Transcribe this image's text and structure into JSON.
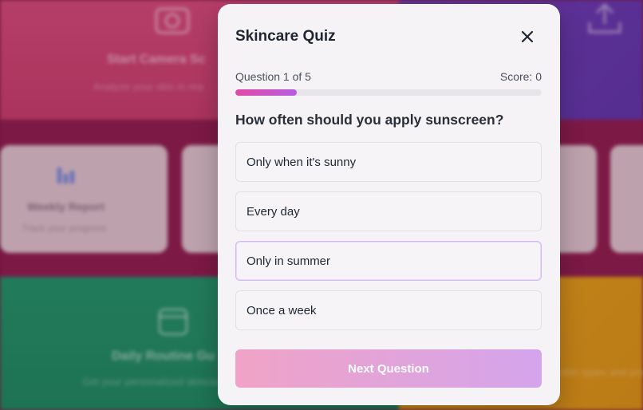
{
  "background": {
    "camera_tile": {
      "title": "Start Camera Sc",
      "subtitle": "Analyze your skin in rea",
      "icon": "camera-icon"
    },
    "upload_tile": {
      "icon": "upload-icon"
    },
    "weekly_card": {
      "title": "Weekly Report",
      "subtitle": "Track your progress",
      "icon": "bar-chart-icon"
    },
    "routine_tile": {
      "title": "Daily Routine Gu",
      "subtitle": "Get your personalized skincar",
      "icon": "calendar-icon"
    },
    "orange_tile": {
      "subtitle": "skin types and prod"
    },
    "colors": {
      "pink": "#c23d6a",
      "purple": "#5b34a8",
      "green": "#178a5f",
      "orange": "#d69313"
    }
  },
  "quiz": {
    "title": "Skincare Quiz",
    "close_icon": "close-icon",
    "progress_text": "Question 1 of 5",
    "score_text": "Score: 0",
    "progress_fraction": 0.2,
    "question": "How often should you apply sunscreen?",
    "options": [
      {
        "label": "Only when it's sunny",
        "selected": false
      },
      {
        "label": "Every day",
        "selected": false
      },
      {
        "label": "Only in summer",
        "selected": true
      },
      {
        "label": "Once a week",
        "selected": false
      }
    ],
    "next_label": "Next Question",
    "accent_colors": {
      "progress_start": "#e24aa5",
      "progress_end": "#b65de0",
      "button_start": "#f0a3c6",
      "button_end": "#d4a4ec"
    }
  }
}
